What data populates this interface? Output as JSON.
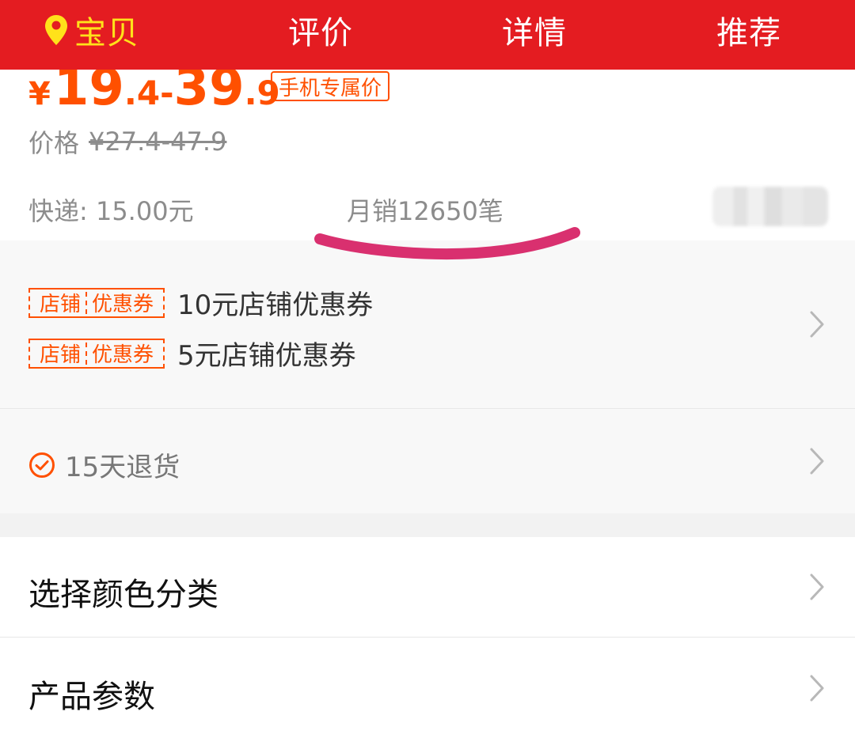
{
  "nav": {
    "tabs": [
      {
        "label": "宝贝",
        "active": true,
        "icon": "location-pin-icon"
      },
      {
        "label": "评价",
        "active": false
      },
      {
        "label": "详情",
        "active": false
      },
      {
        "label": "推荐",
        "active": false
      }
    ],
    "bg_color": "#e41c21",
    "active_color": "#ffe21a"
  },
  "price": {
    "currency": "¥",
    "low_int": "19",
    "low_dec": ".4",
    "dash": "-",
    "high_int": "39",
    "high_dec": ".9",
    "badge": "手机专属价",
    "accent_color": "#ff5000",
    "original_label": "价格",
    "original_value": "¥27.4-47.9"
  },
  "meta": {
    "shipping": "快递: 15.00元",
    "monthly_sales": "月销12650笔"
  },
  "coupons": [
    {
      "tag_left": "店铺",
      "tag_right": "优惠券",
      "text": "10元店铺优惠券"
    },
    {
      "tag_left": "店铺",
      "tag_right": "优惠券",
      "text": "5元店铺优惠券"
    }
  ],
  "service": {
    "return_policy": "15天退货",
    "icon": "check-circle-icon"
  },
  "rows": {
    "select_color": "选择颜色分类",
    "product_params": "产品参数"
  }
}
